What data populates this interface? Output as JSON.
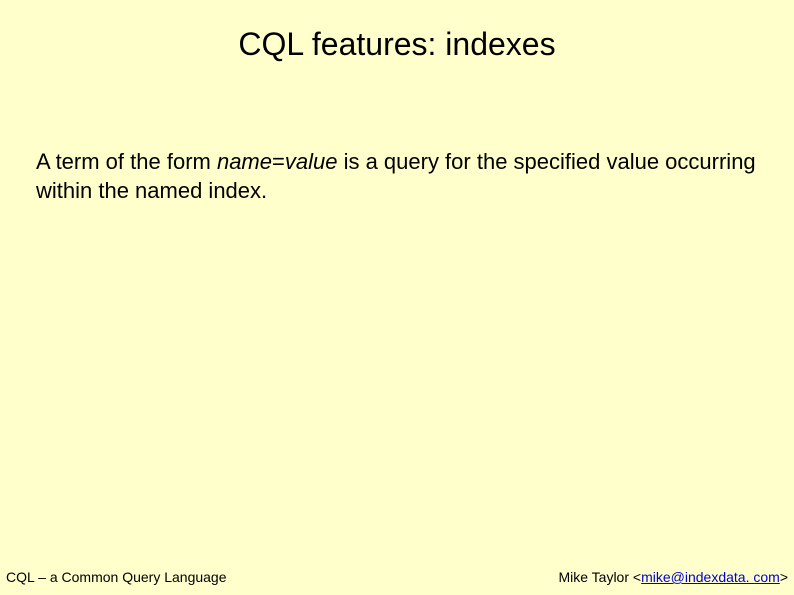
{
  "slide": {
    "title": "CQL features: indexes",
    "body": {
      "pre": "A term of the form ",
      "name": "name",
      "eq": "=",
      "value": "value",
      "post": " is a query for the specified value occurring within the named index."
    },
    "footer": {
      "left": "CQL – a Common Query Language",
      "right_prefix": "Mike Taylor ",
      "lt": "<",
      "email": "mike@indexdata. com",
      "gt": ">"
    }
  }
}
